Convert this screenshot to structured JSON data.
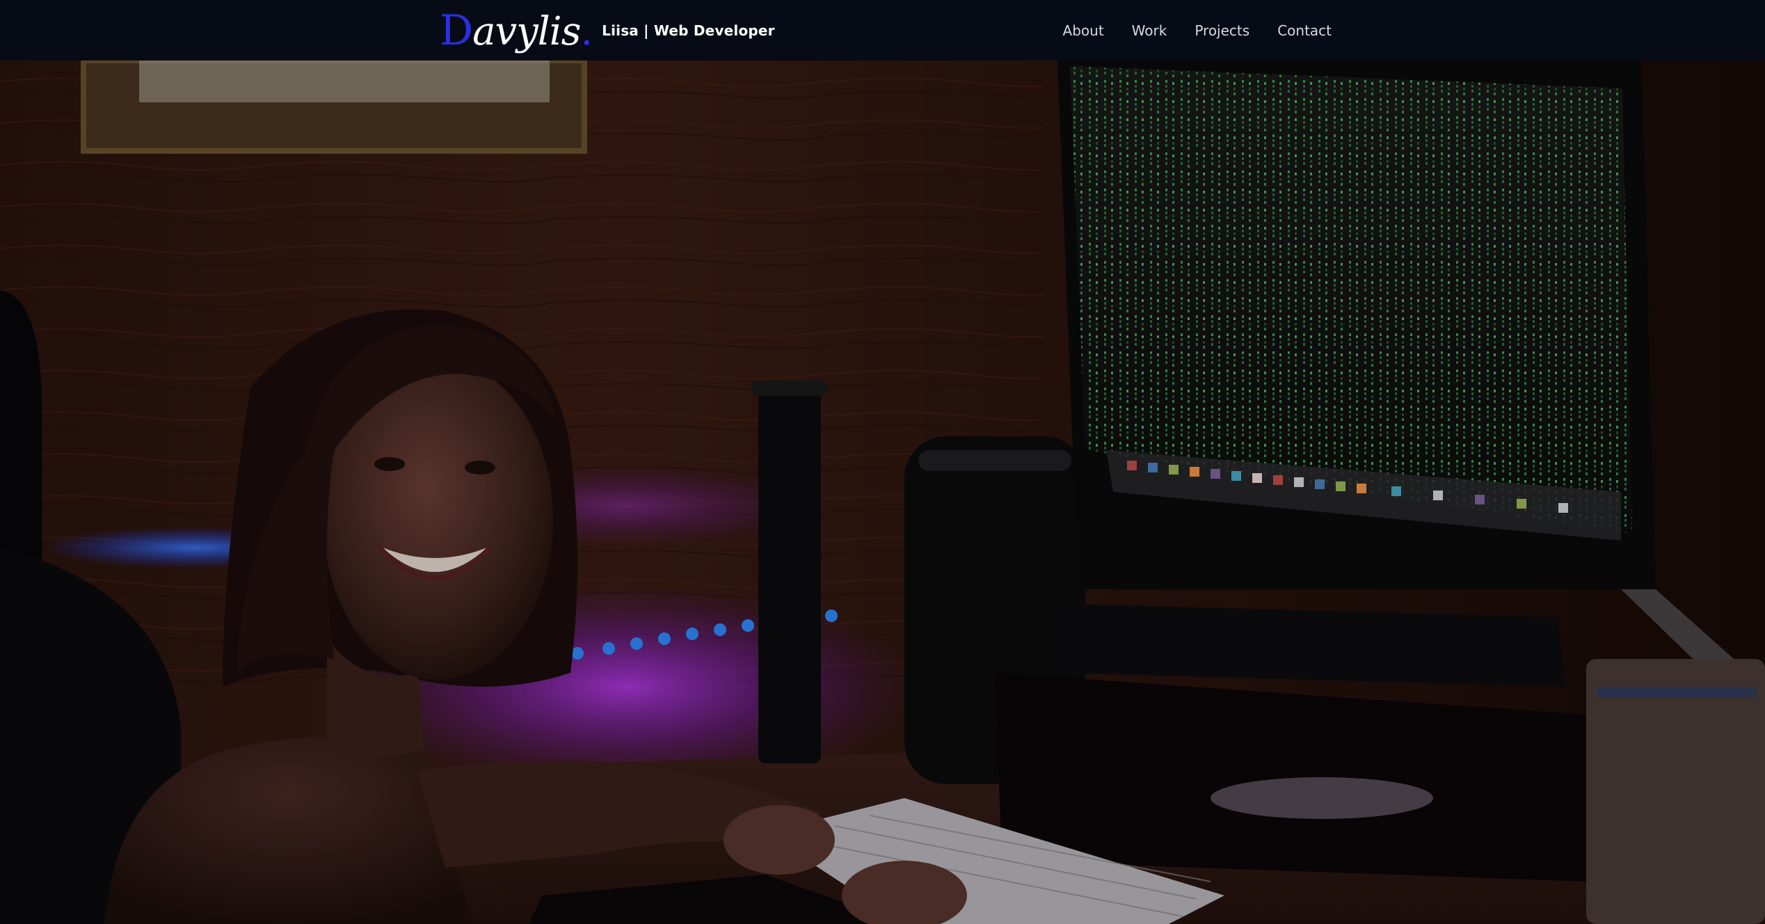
{
  "nav": {
    "logo_initial": "D",
    "logo_rest": "avylis",
    "logo_dot": ".",
    "tagline": "Liisa | Web Developer",
    "links": [
      {
        "label": "About"
      },
      {
        "label": "Work"
      },
      {
        "label": "Projects"
      },
      {
        "label": "Contact"
      }
    ]
  },
  "hero": {
    "image_icon": "photo-icon",
    "accent_color": "#2a2fe0",
    "led_color": "#1e6bff",
    "glow_color": "#a020ff",
    "matrix_color": "#3fbf5a"
  }
}
